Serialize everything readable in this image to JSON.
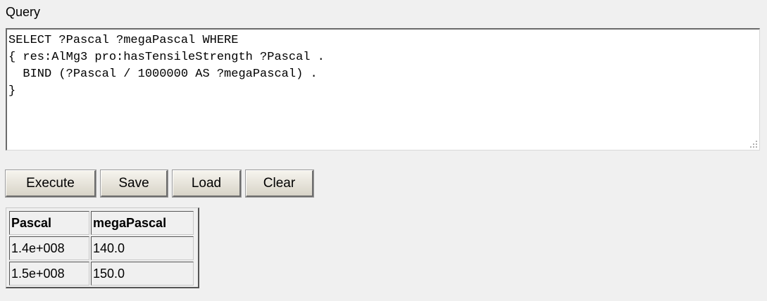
{
  "query_section": {
    "label": "Query",
    "text": "SELECT ?Pascal ?megaPascal WHERE\n{ res:AlMg3 pro:hasTensileStrength ?Pascal .\n  BIND (?Pascal / 1000000 AS ?megaPascal) .\n}"
  },
  "buttons": {
    "execute": "Execute",
    "save": "Save",
    "load": "Load",
    "clear": "Clear"
  },
  "results": {
    "columns": [
      "Pascal",
      "megaPascal"
    ],
    "rows": [
      [
        "1.4e+008",
        "140.0"
      ],
      [
        "1.5e+008",
        "150.0"
      ]
    ]
  }
}
